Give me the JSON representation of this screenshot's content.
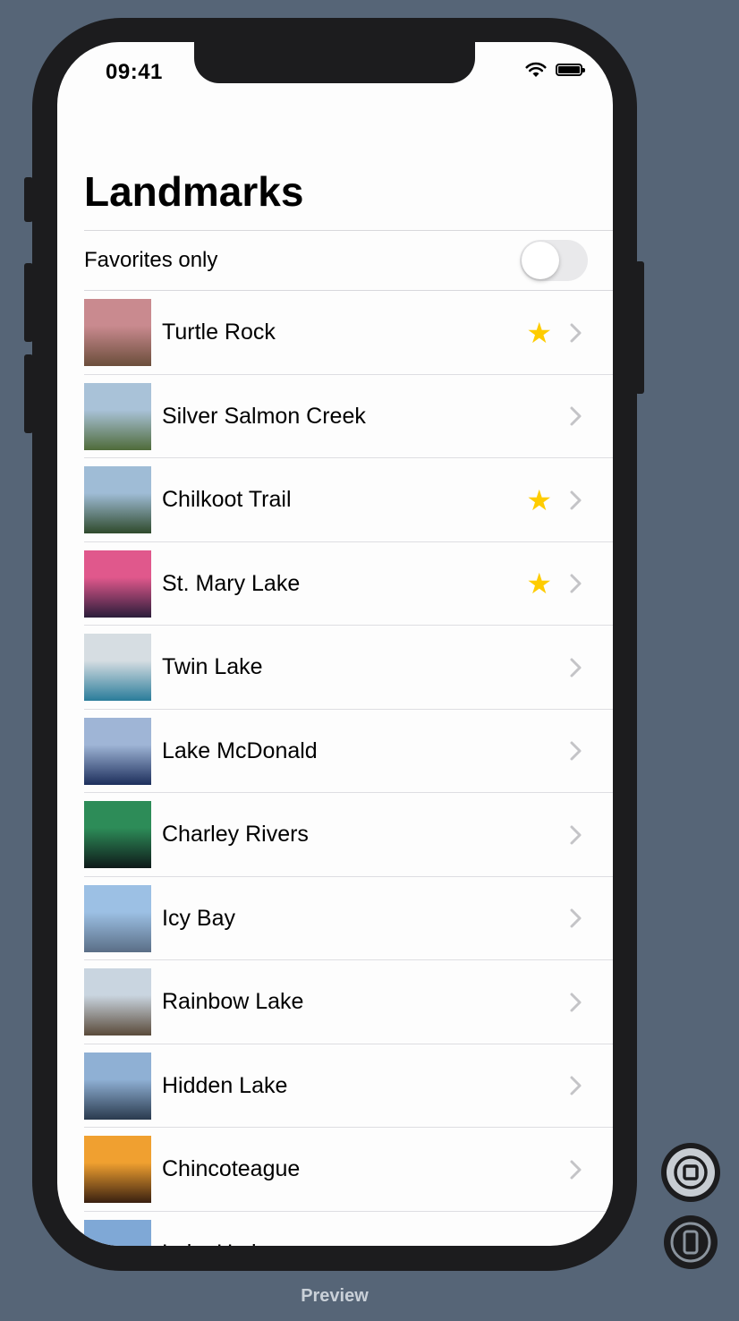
{
  "status_bar": {
    "time": "09:41"
  },
  "nav": {
    "title": "Landmarks"
  },
  "filter": {
    "label": "Favorites only",
    "enabled": false
  },
  "landmarks": [
    {
      "name": "Turtle Rock",
      "favorite": true,
      "thumb": [
        "#c98a8f",
        "#6b4e3b"
      ]
    },
    {
      "name": "Silver Salmon Creek",
      "favorite": false,
      "thumb": [
        "#a9c2d8",
        "#4f6b3a"
      ]
    },
    {
      "name": "Chilkoot Trail",
      "favorite": true,
      "thumb": [
        "#9fbcd6",
        "#2f4a2c"
      ]
    },
    {
      "name": "St. Mary Lake",
      "favorite": true,
      "thumb": [
        "#e0588c",
        "#2b1d3a"
      ]
    },
    {
      "name": "Twin Lake",
      "favorite": false,
      "thumb": [
        "#d6dde2",
        "#2a7c9a"
      ]
    },
    {
      "name": "Lake McDonald",
      "favorite": false,
      "thumb": [
        "#9fb5d6",
        "#1d2f5c"
      ]
    },
    {
      "name": "Charley Rivers",
      "favorite": false,
      "thumb": [
        "#2d8c58",
        "#0f1a1a"
      ]
    },
    {
      "name": "Icy Bay",
      "favorite": false,
      "thumb": [
        "#9cc0e4",
        "#5a6e86"
      ]
    },
    {
      "name": "Rainbow Lake",
      "favorite": false,
      "thumb": [
        "#c9d5e0",
        "#5a4a3a"
      ]
    },
    {
      "name": "Hidden Lake",
      "favorite": false,
      "thumb": [
        "#8fb0d4",
        "#2a3a4e"
      ]
    },
    {
      "name": "Chincoteague",
      "favorite": false,
      "thumb": [
        "#f0a030",
        "#3a2010"
      ]
    },
    {
      "name": "Lake Umbagog",
      "favorite": false,
      "thumb": [
        "#7fa8d6",
        "#3a4e2a"
      ]
    }
  ],
  "colors": {
    "accent_star": "#fecc00",
    "chevron": "#c4c4c7",
    "background": "#566577"
  },
  "footer": {
    "label": "Preview"
  }
}
